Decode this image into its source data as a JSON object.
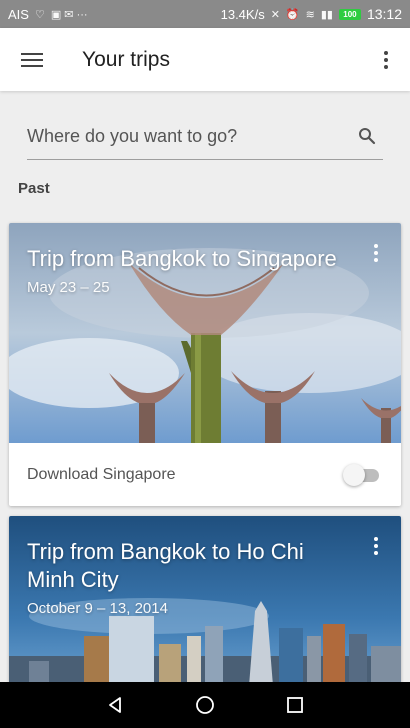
{
  "status_bar": {
    "carrier": "AIS",
    "speed": "13.4K/s",
    "battery": "100",
    "time": "13:12"
  },
  "app_bar": {
    "title": "Your trips"
  },
  "search": {
    "placeholder": "Where do you want to go?"
  },
  "section": {
    "label": "Past"
  },
  "trips": [
    {
      "title": "Trip from Bangkok to Singapore",
      "dates": "May 23 – 25",
      "download_label": "Download Singapore",
      "download_enabled": false
    },
    {
      "title": "Trip from Bangkok to Ho Chi Minh City",
      "dates": "October 9 – 13, 2014"
    }
  ],
  "colors": {
    "status_bar": "#8a8a8a",
    "app_bar": "#ffffff",
    "background": "#eeeeee",
    "nav_bar": "#000000"
  },
  "icons": {
    "menu": "hamburger-menu-icon",
    "overflow": "more-vert-icon",
    "search": "search-icon",
    "nav_back": "back-triangle-icon",
    "nav_home": "home-circle-icon",
    "nav_recents": "recents-square-icon"
  }
}
